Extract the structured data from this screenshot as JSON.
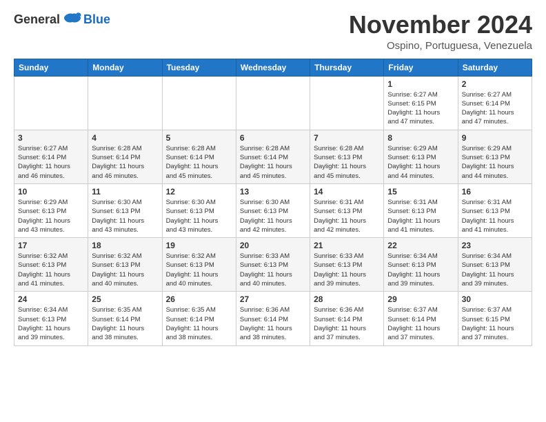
{
  "logo": {
    "general": "General",
    "blue": "Blue"
  },
  "header": {
    "month_title": "November 2024",
    "location": "Ospino, Portuguesa, Venezuela"
  },
  "days_of_week": [
    "Sunday",
    "Monday",
    "Tuesday",
    "Wednesday",
    "Thursday",
    "Friday",
    "Saturday"
  ],
  "weeks": [
    [
      {
        "day": "",
        "info": ""
      },
      {
        "day": "",
        "info": ""
      },
      {
        "day": "",
        "info": ""
      },
      {
        "day": "",
        "info": ""
      },
      {
        "day": "",
        "info": ""
      },
      {
        "day": "1",
        "info": "Sunrise: 6:27 AM\nSunset: 6:15 PM\nDaylight: 11 hours\nand 47 minutes."
      },
      {
        "day": "2",
        "info": "Sunrise: 6:27 AM\nSunset: 6:14 PM\nDaylight: 11 hours\nand 47 minutes."
      }
    ],
    [
      {
        "day": "3",
        "info": "Sunrise: 6:27 AM\nSunset: 6:14 PM\nDaylight: 11 hours\nand 46 minutes."
      },
      {
        "day": "4",
        "info": "Sunrise: 6:28 AM\nSunset: 6:14 PM\nDaylight: 11 hours\nand 46 minutes."
      },
      {
        "day": "5",
        "info": "Sunrise: 6:28 AM\nSunset: 6:14 PM\nDaylight: 11 hours\nand 45 minutes."
      },
      {
        "day": "6",
        "info": "Sunrise: 6:28 AM\nSunset: 6:14 PM\nDaylight: 11 hours\nand 45 minutes."
      },
      {
        "day": "7",
        "info": "Sunrise: 6:28 AM\nSunset: 6:13 PM\nDaylight: 11 hours\nand 45 minutes."
      },
      {
        "day": "8",
        "info": "Sunrise: 6:29 AM\nSunset: 6:13 PM\nDaylight: 11 hours\nand 44 minutes."
      },
      {
        "day": "9",
        "info": "Sunrise: 6:29 AM\nSunset: 6:13 PM\nDaylight: 11 hours\nand 44 minutes."
      }
    ],
    [
      {
        "day": "10",
        "info": "Sunrise: 6:29 AM\nSunset: 6:13 PM\nDaylight: 11 hours\nand 43 minutes."
      },
      {
        "day": "11",
        "info": "Sunrise: 6:30 AM\nSunset: 6:13 PM\nDaylight: 11 hours\nand 43 minutes."
      },
      {
        "day": "12",
        "info": "Sunrise: 6:30 AM\nSunset: 6:13 PM\nDaylight: 11 hours\nand 43 minutes."
      },
      {
        "day": "13",
        "info": "Sunrise: 6:30 AM\nSunset: 6:13 PM\nDaylight: 11 hours\nand 42 minutes."
      },
      {
        "day": "14",
        "info": "Sunrise: 6:31 AM\nSunset: 6:13 PM\nDaylight: 11 hours\nand 42 minutes."
      },
      {
        "day": "15",
        "info": "Sunrise: 6:31 AM\nSunset: 6:13 PM\nDaylight: 11 hours\nand 41 minutes."
      },
      {
        "day": "16",
        "info": "Sunrise: 6:31 AM\nSunset: 6:13 PM\nDaylight: 11 hours\nand 41 minutes."
      }
    ],
    [
      {
        "day": "17",
        "info": "Sunrise: 6:32 AM\nSunset: 6:13 PM\nDaylight: 11 hours\nand 41 minutes."
      },
      {
        "day": "18",
        "info": "Sunrise: 6:32 AM\nSunset: 6:13 PM\nDaylight: 11 hours\nand 40 minutes."
      },
      {
        "day": "19",
        "info": "Sunrise: 6:32 AM\nSunset: 6:13 PM\nDaylight: 11 hours\nand 40 minutes."
      },
      {
        "day": "20",
        "info": "Sunrise: 6:33 AM\nSunset: 6:13 PM\nDaylight: 11 hours\nand 40 minutes."
      },
      {
        "day": "21",
        "info": "Sunrise: 6:33 AM\nSunset: 6:13 PM\nDaylight: 11 hours\nand 39 minutes."
      },
      {
        "day": "22",
        "info": "Sunrise: 6:34 AM\nSunset: 6:13 PM\nDaylight: 11 hours\nand 39 minutes."
      },
      {
        "day": "23",
        "info": "Sunrise: 6:34 AM\nSunset: 6:13 PM\nDaylight: 11 hours\nand 39 minutes."
      }
    ],
    [
      {
        "day": "24",
        "info": "Sunrise: 6:34 AM\nSunset: 6:13 PM\nDaylight: 11 hours\nand 39 minutes."
      },
      {
        "day": "25",
        "info": "Sunrise: 6:35 AM\nSunset: 6:14 PM\nDaylight: 11 hours\nand 38 minutes."
      },
      {
        "day": "26",
        "info": "Sunrise: 6:35 AM\nSunset: 6:14 PM\nDaylight: 11 hours\nand 38 minutes."
      },
      {
        "day": "27",
        "info": "Sunrise: 6:36 AM\nSunset: 6:14 PM\nDaylight: 11 hours\nand 38 minutes."
      },
      {
        "day": "28",
        "info": "Sunrise: 6:36 AM\nSunset: 6:14 PM\nDaylight: 11 hours\nand 37 minutes."
      },
      {
        "day": "29",
        "info": "Sunrise: 6:37 AM\nSunset: 6:14 PM\nDaylight: 11 hours\nand 37 minutes."
      },
      {
        "day": "30",
        "info": "Sunrise: 6:37 AM\nSunset: 6:15 PM\nDaylight: 11 hours\nand 37 minutes."
      }
    ]
  ]
}
